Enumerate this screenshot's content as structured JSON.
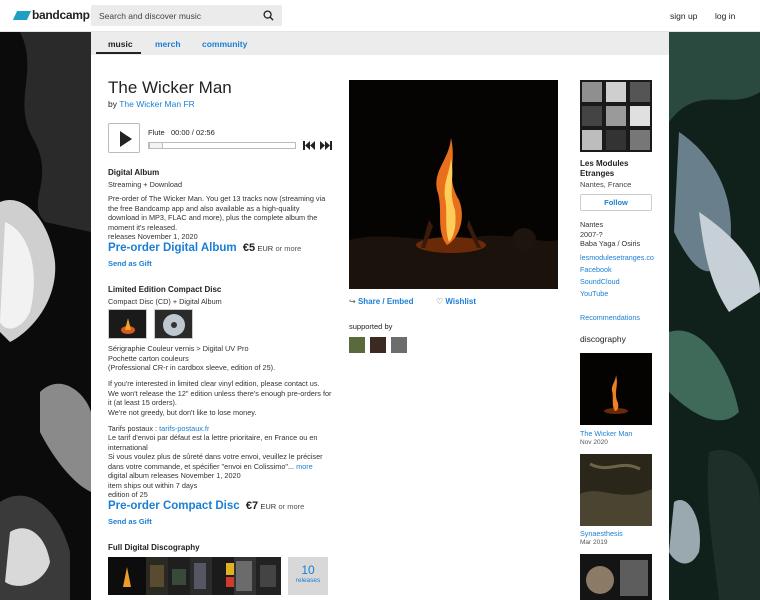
{
  "header": {
    "logo_text": "bandcamp",
    "search_placeholder": "Search and discover music",
    "signup": "sign up",
    "login": "log in"
  },
  "tabs": [
    "music",
    "merch",
    "community"
  ],
  "album": {
    "title": "The Wicker Man",
    "by_prefix": "by",
    "artist": "The Wicker Man FR"
  },
  "player": {
    "track": "Flute",
    "time": "00:00 / 02:56",
    "progress": 0
  },
  "digital": {
    "heading": "Digital Album",
    "subhead": "Streaming + Download",
    "desc": [
      "Pre-order of The Wicker Man. You get 13 tracks now (streaming via",
      "the free Bandcamp app and also available as a high-quality",
      "download in MP3, FLAC and more), plus the complete album the",
      "moment it's released."
    ],
    "releases": "releases November 1, 2020",
    "buy_label": "Pre-order Digital Album",
    "price": "€5",
    "currency": "EUR",
    "or_more": "or more",
    "gift": "Send as Gift"
  },
  "cd": {
    "heading": "Limited Edition Compact Disc",
    "subhead": "Compact Disc (CD) + Digital Album",
    "desc1": [
      "Sérigraphie Couleur vernis > Digital UV Pro",
      "Pochette carton couleurs",
      "(Professional CR-r in cardbox sleeve, edition of 25)."
    ],
    "desc2": [
      "If you're interested in limited clear vinyl edition, please contact us.",
      "We won't release the 12\" edition unless there's enough pre-orders for",
      "it (at least 15 orders).",
      "We're not greedy, but don't like to lose money."
    ],
    "tarifs_prefix": "Tarifs postaux :",
    "tarifs_link": "tarifs-postaux.fr",
    "desc3": [
      "Le tarif d'envoi par défaut est la lettre prioritaire, en France ou en",
      "international",
      "Si vous voulez plus de sûreté dans votre envoi, veuillez le préciser",
      "dans votre commande, et spécifier \"envoi en Colissimo\"..."
    ],
    "more": "more",
    "release_info": [
      "digital album releases November 1, 2020",
      "item ships out within 7 days",
      "edition of 25"
    ],
    "buy_label": "Pre-order Compact Disc",
    "price": "€7",
    "currency": "EUR",
    "or_more": "or more",
    "gift": "Send as Gift"
  },
  "discography_full": {
    "heading": "Full Digital Discography",
    "count": "10",
    "count_label": "releases"
  },
  "actions": {
    "share": "Share / Embed",
    "wishlist": "Wishlist"
  },
  "supported_by": "supported by",
  "band": {
    "name_line1": "Les Modules",
    "name_line2": "Etranges",
    "location": "Nantes, France",
    "follow": "Follow",
    "bio": [
      "Nantes",
      "2007-?",
      "Baba Yaga / Osiris"
    ],
    "links": [
      "lesmodulesetranges.com",
      "Facebook",
      "SoundCloud",
      "YouTube"
    ],
    "recommendations": "Recommendations",
    "discography_heading": "discography",
    "releases": [
      {
        "title": "The Wicker Man",
        "date": "Nov 2020"
      },
      {
        "title": "Synaesthesis",
        "date": "Mar 2019"
      }
    ]
  },
  "colors": {
    "link": "#1a7fd4",
    "logo": "#1da0c3",
    "tabs_bg": "#ececec"
  }
}
